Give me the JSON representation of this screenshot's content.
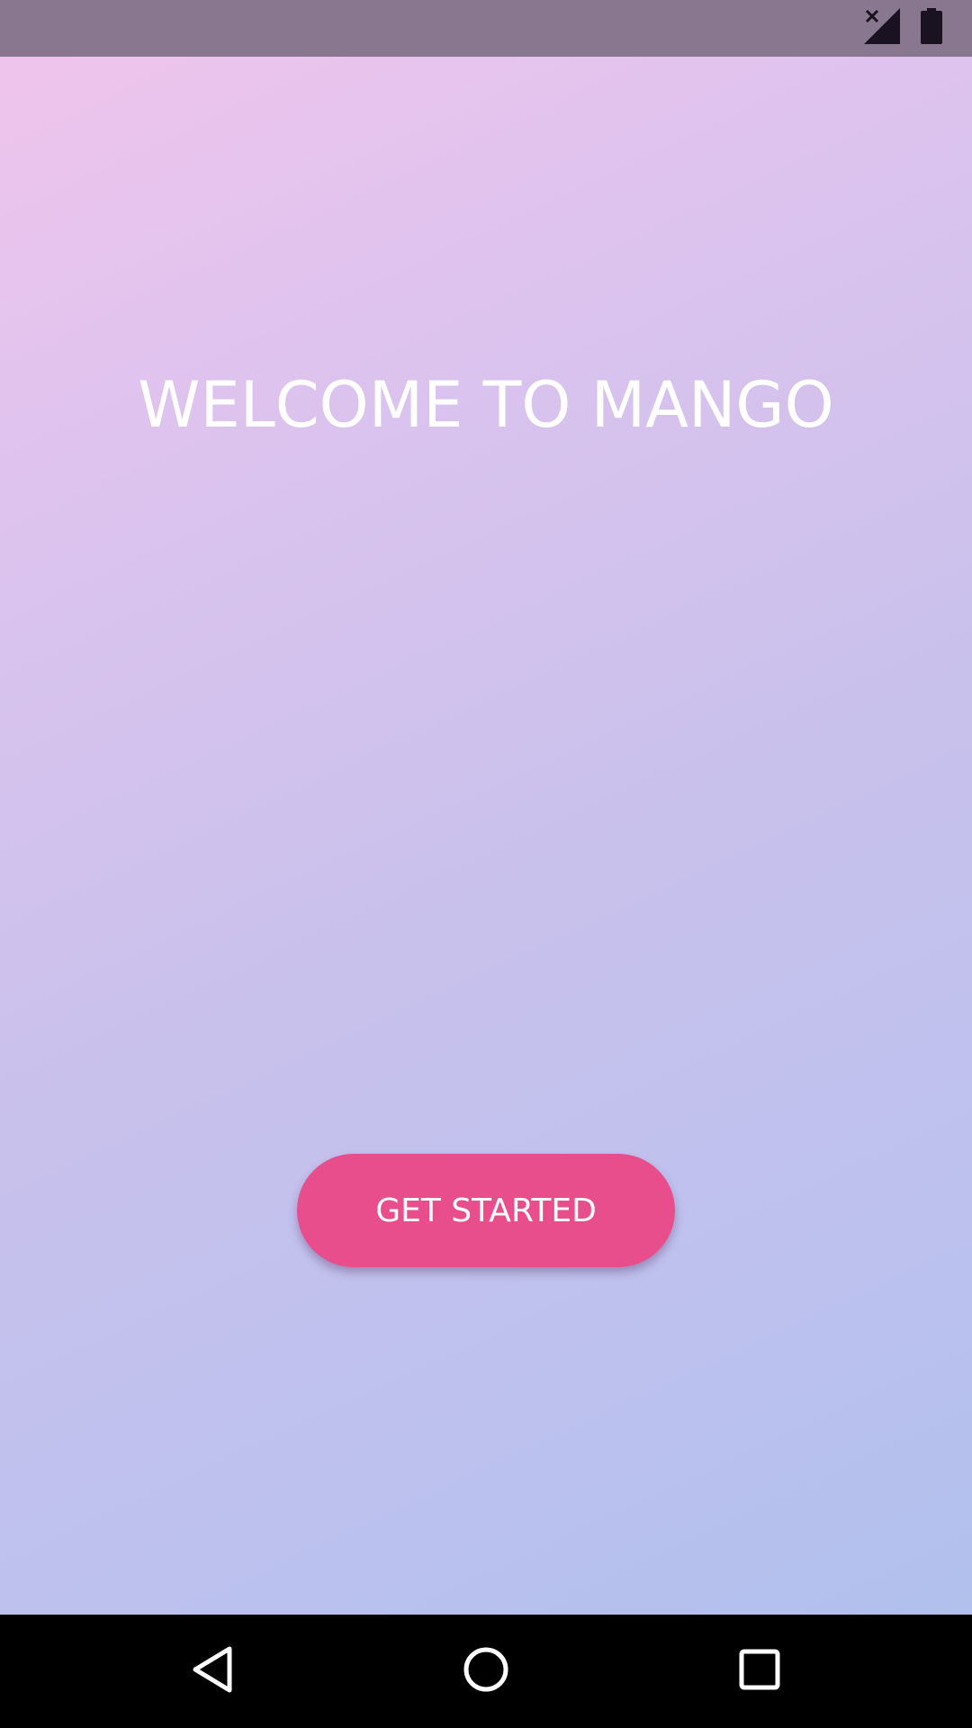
{
  "status_bar": {
    "icons": [
      "signal-no-service-icon",
      "battery-full-icon"
    ]
  },
  "welcome": {
    "title": "WELCOME TO MANGO"
  },
  "cta": {
    "label": "GET STARTED",
    "color": "#e84e8b"
  },
  "nav_bar": {
    "icons": [
      "back-icon",
      "home-icon",
      "recents-icon"
    ]
  }
}
